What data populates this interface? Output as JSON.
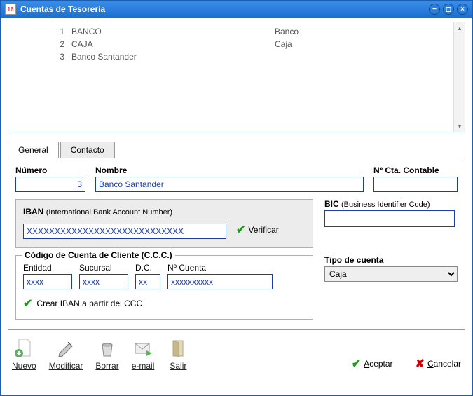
{
  "window": {
    "title": "Cuentas de Tesorería"
  },
  "list": {
    "rows": [
      {
        "num": "1",
        "name": "BANCO",
        "type": "Banco"
      },
      {
        "num": "2",
        "name": "CAJA",
        "type": "Caja"
      },
      {
        "num": "3",
        "name": "Banco Santander",
        "type": ""
      }
    ]
  },
  "tabs": {
    "general": "General",
    "contacto": "Contacto"
  },
  "fields": {
    "numero": {
      "label": "Número",
      "value": "3"
    },
    "nombre": {
      "label": "Nombre",
      "value": "Banco Santander"
    },
    "cta": {
      "label": "Nº Cta. Contable",
      "value": ""
    }
  },
  "iban": {
    "label": "IBAN",
    "sublabel": "(International Bank Account Number)",
    "value": "XXXXXXXXXXXXXXXXXXXXXXXXXXXX",
    "verify": "Verificar"
  },
  "bic": {
    "label": "BIC",
    "sublabel": "(Business Identifier Code)",
    "value": ""
  },
  "ccc": {
    "legend": "Código de Cuenta de Cliente (C.C.C.)",
    "entidad": {
      "label": "Entidad",
      "value": "xxxx"
    },
    "sucursal": {
      "label": "Sucursal",
      "value": "xxxx"
    },
    "dc": {
      "label": "D.C.",
      "value": "xx"
    },
    "ncuenta": {
      "label": "Nº Cuenta",
      "value": "xxxxxxxxxx"
    },
    "crear": "Crear IBAN a partir del CCC"
  },
  "tipo": {
    "label": "Tipo de cuenta",
    "value": "Caja"
  },
  "toolbar": {
    "nuevo": "Nuevo",
    "modificar": "Modificar",
    "borrar": "Borrar",
    "email": "e-mail",
    "salir": "Salir"
  },
  "actions": {
    "aceptar": "Aceptar",
    "cancelar": "Cancelar"
  }
}
